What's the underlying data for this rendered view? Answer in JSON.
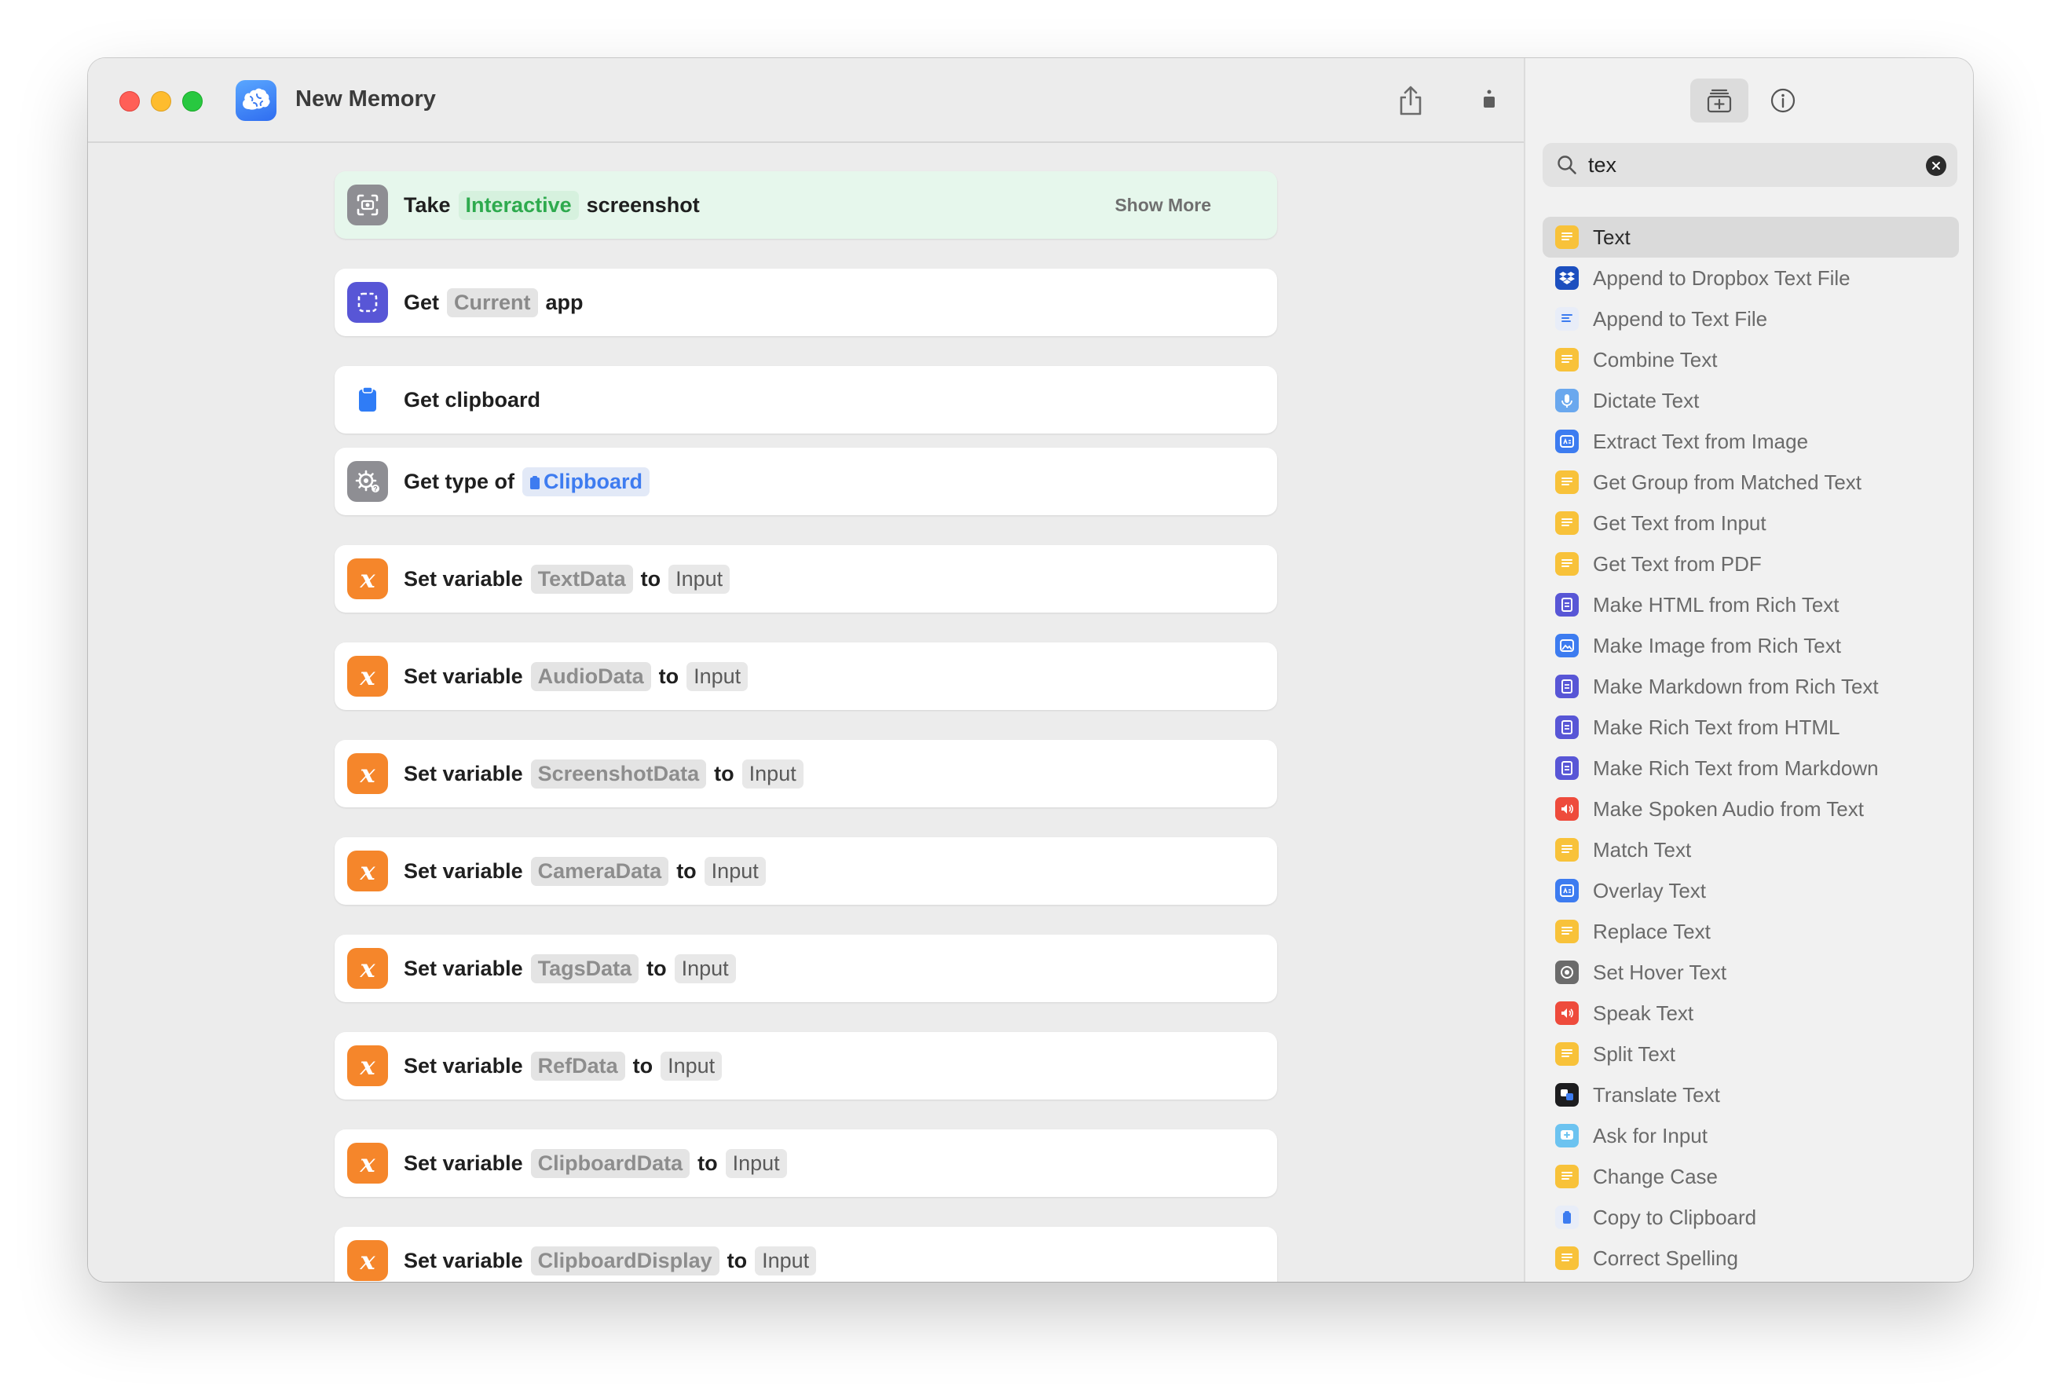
{
  "window": {
    "title": "New Memory"
  },
  "toolbar": {
    "share": "share-icon",
    "run": "play-icon"
  },
  "actions": [
    {
      "verb": "Take",
      "param": "Interactive",
      "tail": "screenshot",
      "extra": "Show More",
      "icon": "screenshot-icon",
      "color": "#8e8e93"
    },
    {
      "verb": "Get",
      "param": "Current",
      "tail": "app",
      "icon": "app-icon",
      "color": "#5856d6"
    },
    {
      "verb": "Get clipboard",
      "icon": "clipboard-icon",
      "color": "#ffffff"
    },
    {
      "verb": "Get type of",
      "param": "Clipboard",
      "icon": "gear-icon",
      "color": "#8e8e93"
    },
    {
      "verb": "Set variable",
      "var": "TextData",
      "to": "to",
      "value": "Input",
      "icon": "variable-icon",
      "color": "#f5862b"
    },
    {
      "verb": "Set variable",
      "var": "AudioData",
      "to": "to",
      "value": "Input",
      "icon": "variable-icon",
      "color": "#f5862b"
    },
    {
      "verb": "Set variable",
      "var": "ScreenshotData",
      "to": "to",
      "value": "Input",
      "icon": "variable-icon",
      "color": "#f5862b"
    },
    {
      "verb": "Set variable",
      "var": "CameraData",
      "to": "to",
      "value": "Input",
      "icon": "variable-icon",
      "color": "#f5862b"
    },
    {
      "verb": "Set variable",
      "var": "TagsData",
      "to": "to",
      "value": "Input",
      "icon": "variable-icon",
      "color": "#f5862b"
    },
    {
      "verb": "Set variable",
      "var": "RefData",
      "to": "to",
      "value": "Input",
      "icon": "variable-icon",
      "color": "#f5862b"
    },
    {
      "verb": "Set variable",
      "var": "ClipboardData",
      "to": "to",
      "value": "Input",
      "icon": "variable-icon",
      "color": "#f5862b"
    },
    {
      "verb": "Set variable",
      "var": "ClipboardDisplay",
      "to": "to",
      "value": "Input",
      "icon": "variable-icon",
      "color": "#f5862b"
    }
  ],
  "sidebar": {
    "search": {
      "value": "tex",
      "placeholder": "Search"
    },
    "items": [
      {
        "label": "Text",
        "icon": "text-icon",
        "color": "#f8c23a",
        "selected": true
      },
      {
        "label": "Append to Dropbox Text File",
        "icon": "dropbox-icon",
        "color": "#1c4fbf"
      },
      {
        "label": "Append to Text File",
        "icon": "file-icon",
        "color": "#e8edf8"
      },
      {
        "label": "Combine Text",
        "icon": "text-icon",
        "color": "#f8c23a"
      },
      {
        "label": "Dictate Text",
        "icon": "microphone-icon",
        "color": "#6aa8ee"
      },
      {
        "label": "Extract Text from Image",
        "icon": "image-text-icon",
        "color": "#3d7cf0"
      },
      {
        "label": "Get Group from Matched Text",
        "icon": "text-icon",
        "color": "#f8c23a"
      },
      {
        "label": "Get Text from Input",
        "icon": "text-icon",
        "color": "#f8c23a"
      },
      {
        "label": "Get Text from PDF",
        "icon": "text-icon",
        "color": "#f8c23a"
      },
      {
        "label": "Make HTML from Rich Text",
        "icon": "document-icon",
        "color": "#5856d6"
      },
      {
        "label": "Make Image from Rich Text",
        "icon": "image-icon",
        "color": "#3d7cf0"
      },
      {
        "label": "Make Markdown from Rich Text",
        "icon": "document-icon",
        "color": "#5856d6"
      },
      {
        "label": "Make Rich Text from HTML",
        "icon": "document-icon",
        "color": "#5856d6"
      },
      {
        "label": "Make Rich Text from Markdown",
        "icon": "document-icon",
        "color": "#5856d6"
      },
      {
        "label": "Make Spoken Audio from Text",
        "icon": "speaker-icon",
        "color": "#ee4b3c"
      },
      {
        "label": "Match Text",
        "icon": "text-icon",
        "color": "#f8c23a"
      },
      {
        "label": "Overlay Text",
        "icon": "image-text-icon",
        "color": "#3d7cf0"
      },
      {
        "label": "Replace Text",
        "icon": "text-icon",
        "color": "#f8c23a"
      },
      {
        "label": "Set Hover Text",
        "icon": "hover-icon",
        "color": "#6b6b6b"
      },
      {
        "label": "Speak Text",
        "icon": "speaker-icon",
        "color": "#ee4b3c"
      },
      {
        "label": "Split Text",
        "icon": "text-icon",
        "color": "#f8c23a"
      },
      {
        "label": "Translate Text",
        "icon": "translate-icon",
        "color": "#1d1d1f"
      },
      {
        "label": "Ask for Input",
        "icon": "ask-input-icon",
        "color": "#6cc3f0"
      },
      {
        "label": "Change Case",
        "icon": "text-icon",
        "color": "#f8c23a"
      },
      {
        "label": "Copy to Clipboard",
        "icon": "clipboard-icon",
        "color": "#e8edf8"
      },
      {
        "label": "Correct Spelling",
        "icon": "text-icon",
        "color": "#f8c23a"
      }
    ]
  }
}
